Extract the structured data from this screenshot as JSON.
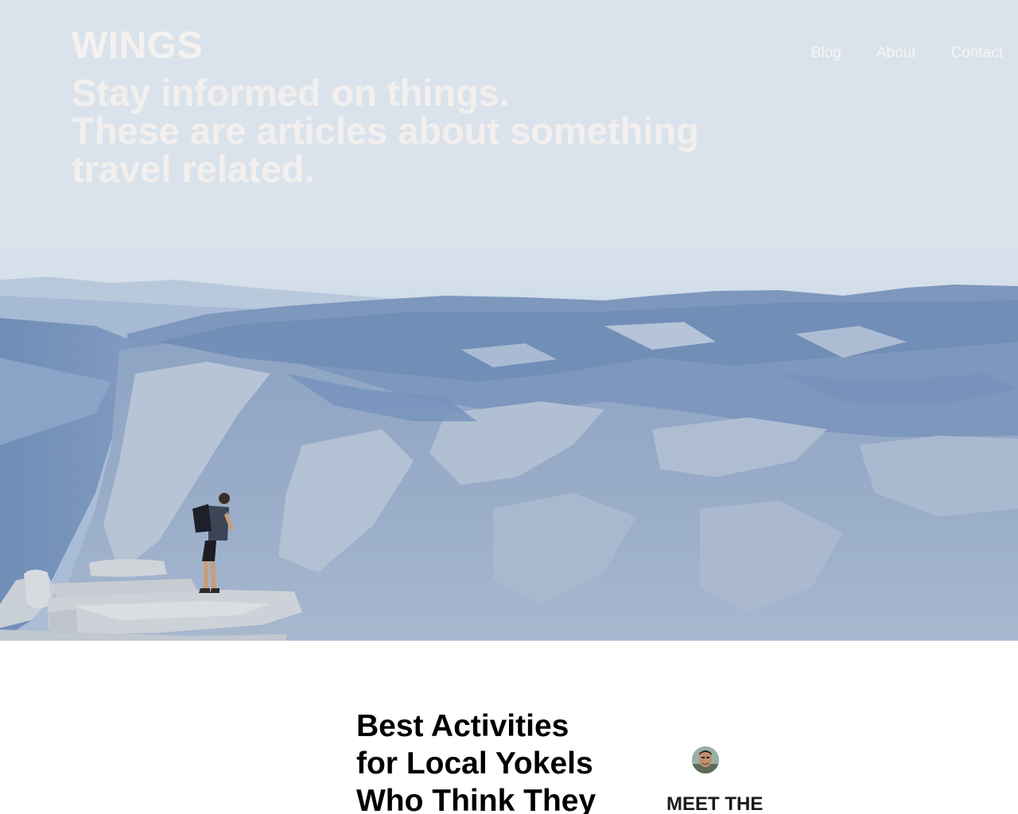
{
  "header": {
    "brand": "WINGS",
    "nav": [
      "Blog",
      "About",
      "Contact"
    ]
  },
  "hero": {
    "tagline_lines": [
      "Stay informed on things.",
      "These are articles about something",
      "travel related."
    ]
  },
  "article": {
    "title_lines": [
      "Best Activities",
      "for Local Yokels",
      "Who Think They"
    ]
  },
  "sidebar": {
    "heading": "MEET THE"
  },
  "colors": {
    "hero_sky": "#dae3ec",
    "hero_text": "#f5f1ef",
    "body_text": "#000000",
    "background": "#ffffff"
  }
}
